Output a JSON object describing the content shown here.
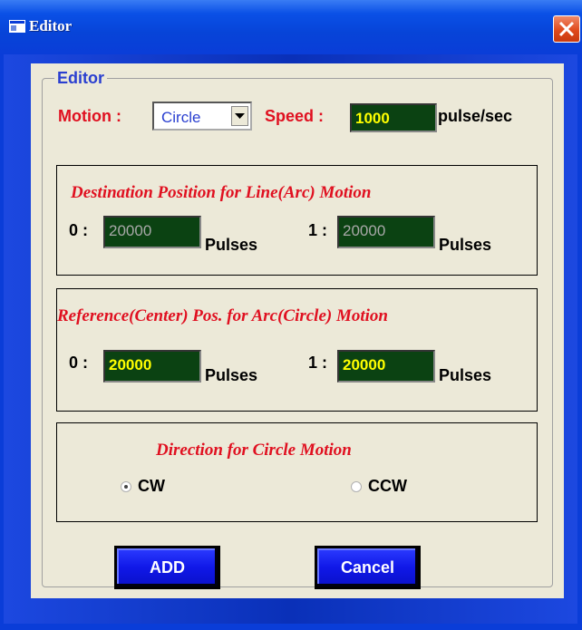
{
  "window": {
    "title": "Editor"
  },
  "editor_group": {
    "legend": "Editor"
  },
  "motion": {
    "label": "Motion :",
    "selected": "Circle"
  },
  "speed": {
    "label": "Speed :",
    "value": "1000",
    "unit": "pulse/sec"
  },
  "destination_panel": {
    "title": "Destination Position for Line(Arc) Motion",
    "axis0_label": "0 :",
    "axis0_value": "20000",
    "axis0_unit": "Pulses",
    "axis1_label": "1 :",
    "axis1_value": "20000",
    "axis1_unit": "Pulses"
  },
  "reference_panel": {
    "title": "Reference(Center) Pos. for Arc(Circle) Motion",
    "axis0_label": "0 :",
    "axis0_value": "20000",
    "axis0_unit": "Pulses",
    "axis1_label": "1 :",
    "axis1_value": "20000",
    "axis1_unit": "Pulses"
  },
  "direction_panel": {
    "title": "Direction for Circle Motion",
    "cw_label": "CW",
    "ccw_label": "CCW",
    "selected": "CW"
  },
  "buttons": {
    "add": "ADD",
    "cancel": "Cancel"
  },
  "colors": {
    "titlebar": "#0a50e6",
    "accent_red": "#e01020",
    "field_bg": "#0b4212",
    "field_text_active": "#ffff00",
    "button_blue": "#1018e8"
  },
  "icons": {
    "title": "window-app-icon",
    "close": "close-icon",
    "dropdown": "chevron-down-icon"
  }
}
